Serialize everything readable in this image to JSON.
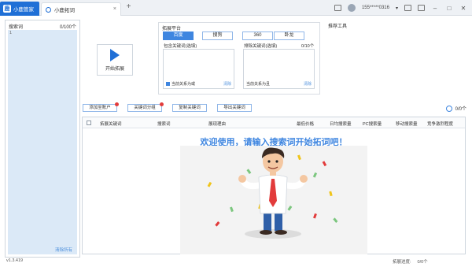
{
  "titlebar": {
    "app_name": "小鹿管家",
    "tab_title": "小鹿拓词",
    "user": "155*****0316",
    "close_symbol": "×",
    "new_tab_symbol": "+",
    "dropdown_symbol": "▾",
    "window_min": "–",
    "window_max": "□",
    "window_close": "✕"
  },
  "left_panel": {
    "title": "搜索词",
    "count": "0/100个",
    "line_number": "1",
    "clear_label": "清除所有"
  },
  "start_button": {
    "label": "开始拓展"
  },
  "platform": {
    "title": "拓展平台",
    "buttons": [
      {
        "label": "百度",
        "active": true
      },
      {
        "label": "搜狗",
        "active": false
      },
      {
        "label": "360",
        "active": false
      },
      {
        "label": "卧龙",
        "active": false
      }
    ],
    "include": {
      "label": "包含关键词(选填)",
      "count": "",
      "option": "当前关系为或",
      "clear": "清除",
      "checked": true
    },
    "exclude": {
      "label": "排除关键词(选填)",
      "count": "0/10个",
      "option": "当前关系为且",
      "clear": "清除",
      "checked": false
    }
  },
  "recommend_tools": "推荐工具",
  "toolbar": {
    "buttons": [
      "添加至账户",
      "关键词分组",
      "复制关键词",
      "导出关键词"
    ],
    "count": "0/0个"
  },
  "table": {
    "headers": [
      "拓展关键词",
      "搜索词",
      "展现理由",
      "最低价格",
      "日均搜索量",
      "PC搜索量",
      "移动搜索量",
      "竞争激烈程度"
    ]
  },
  "welcome": "欢迎使用，请输入搜索词开始拓词吧！",
  "footer": {
    "version": "v1.3.419",
    "progress_label": "拓展进度:",
    "progress_value": "0/0个"
  },
  "colors": {
    "accent": "#3f86e0",
    "brand": "#1f6fd6",
    "alert": "#e23b3b"
  }
}
